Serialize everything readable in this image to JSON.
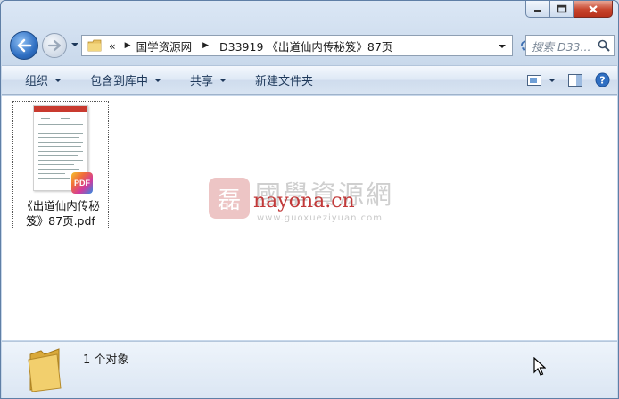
{
  "window": {
    "caption_buttons": [
      "minimize",
      "maximize",
      "close"
    ]
  },
  "nav": {
    "breadcrumb": [
      "«",
      "国学资源网",
      "D33919 《出道仙内传秘笈》87页"
    ],
    "search_placeholder": "搜索 D33..."
  },
  "toolbar": {
    "organize": "组织",
    "include_library": "包含到库中",
    "share": "共享",
    "new_folder": "新建文件夹"
  },
  "file": {
    "name_line1": "《出道仙内传秘",
    "name_line2": "笈》87页.pdf",
    "badge": "PDF"
  },
  "watermark": {
    "cn_text": "國學資源網",
    "url": "nayona.cn",
    "url2": "www.guoxueziyuan.com"
  },
  "status": {
    "count": "1 个对象"
  },
  "colors": {
    "accent": "#1e395b",
    "close_red": "#c7442c",
    "watermark_red": "#c23a3a"
  }
}
